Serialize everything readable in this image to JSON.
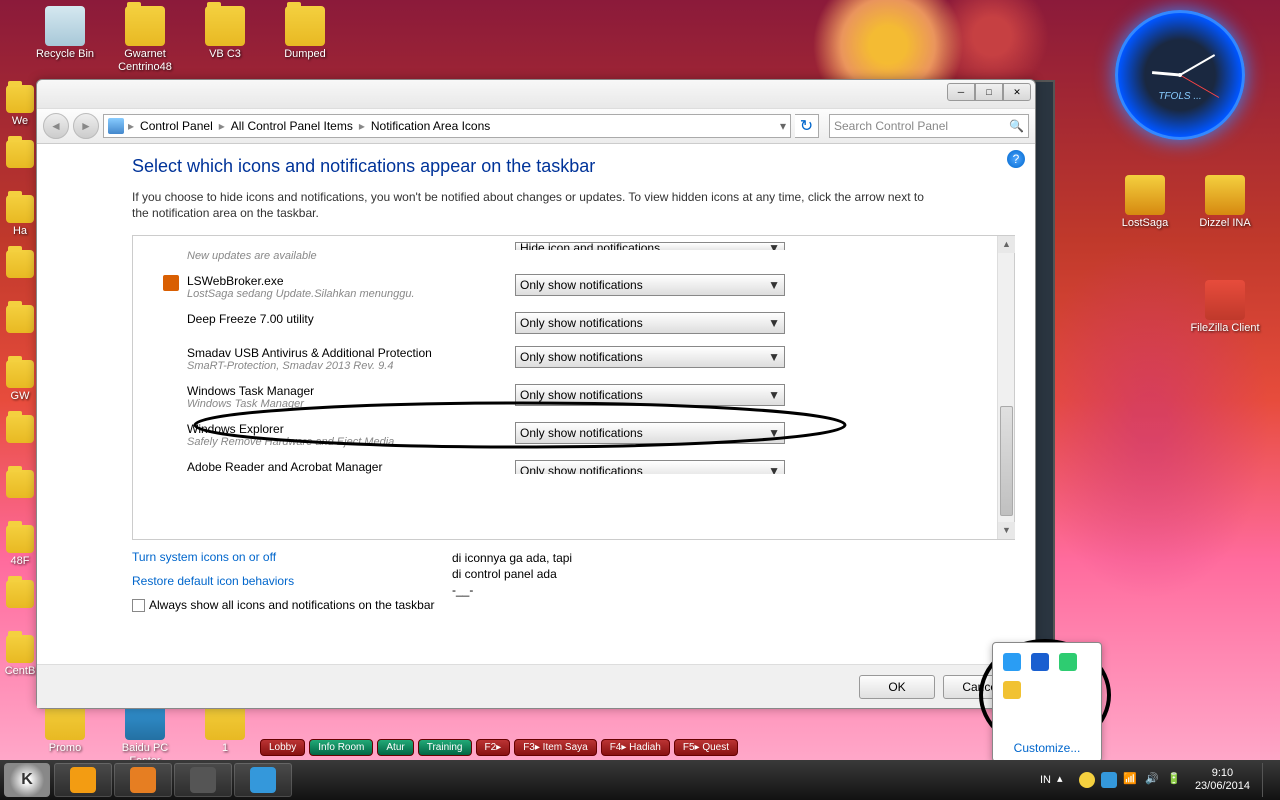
{
  "desktop": {
    "icons": [
      {
        "label": "Recycle Bin",
        "type": "bin"
      },
      {
        "label": "Gwarnet Centrino48",
        "type": "folder"
      },
      {
        "label": "VB C3",
        "type": "folder"
      },
      {
        "label": "Dumped",
        "type": "folder"
      }
    ],
    "left_icons": [
      "We",
      "",
      "Ha",
      "",
      "",
      "GW",
      "",
      "",
      "48F",
      "",
      "CentB"
    ],
    "bottom_icons": [
      {
        "label": "Promo"
      },
      {
        "label": "Baidu PC Faster"
      },
      {
        "label": "1"
      }
    ],
    "right_icons": [
      {
        "label": "LostSaga"
      },
      {
        "label": "Dizzel INA"
      },
      {
        "label": "FileZilla Client"
      }
    ],
    "clock_text": "TFOLS ..."
  },
  "window": {
    "titlebar_buttons": [
      "─",
      "□",
      "✕"
    ],
    "breadcrumb": [
      "Control Panel",
      "All Control Panel Items",
      "Notification Area Icons"
    ],
    "search_placeholder": "Search Control Panel",
    "heading": "Select which icons and notifications appear on the taskbar",
    "description": "If you choose to hide icons and notifications, you won't be notified about changes or updates. To view hidden icons at any time, click the arrow next to the notification area on the taskbar.",
    "rows": [
      {
        "name": "",
        "detail": "New updates are available",
        "behavior": "Hide icon and notifications",
        "top_cut": true
      },
      {
        "name": "LSWebBroker.exe",
        "detail": "LostSaga sedang Update.Silahkan menunggu.",
        "behavior": "Only show notifications",
        "icon": "#d95f02"
      },
      {
        "name": "Deep Freeze 7.00 utility",
        "detail": "",
        "behavior": "Only show notifications",
        "icon": "",
        "circled": true
      },
      {
        "name": "Smadav USB Antivirus & Additional Protection",
        "detail": "SmaRT-Protection, Smadav 2013 Rev. 9.4",
        "behavior": "Only show notifications",
        "icon": ""
      },
      {
        "name": "Windows Task Manager",
        "detail": "Windows Task Manager",
        "behavior": "Only show notifications",
        "icon": ""
      },
      {
        "name": "Windows Explorer",
        "detail": "Safely Remove Hardware and Eject Media",
        "behavior": "Only show notifications",
        "icon": ""
      },
      {
        "name": "Adobe Reader and Acrobat Manager",
        "detail": "",
        "behavior": "Only show notifications",
        "icon": "",
        "bottom_cut": true
      }
    ],
    "link1": "Turn system icons on or off",
    "link2": "Restore default icon behaviors",
    "checkbox_label": "Always show all icons and notifications on the taskbar",
    "annotation": "di iconnya ga ada, tapi\ndi control panel ada\n-__-",
    "ok": "OK",
    "cancel": "Cancel"
  },
  "tray_popup": {
    "customize": "Customize...",
    "icons": [
      "#2a9df4",
      "#1a5fd0",
      "#2ecc71",
      "#f1c232"
    ]
  },
  "taskbar": {
    "items": [
      "#f39c12",
      "#e67e22",
      "#555",
      "#3498db"
    ],
    "lang": "IN",
    "time": "9:10",
    "date": "23/06/2014"
  },
  "game_toolbar": [
    "Lobby",
    "Info Room",
    "Atur",
    "Training",
    "F2▸",
    "F3▸ Item Saya",
    "F4▸ Hadiah",
    "F5▸ Quest"
  ]
}
